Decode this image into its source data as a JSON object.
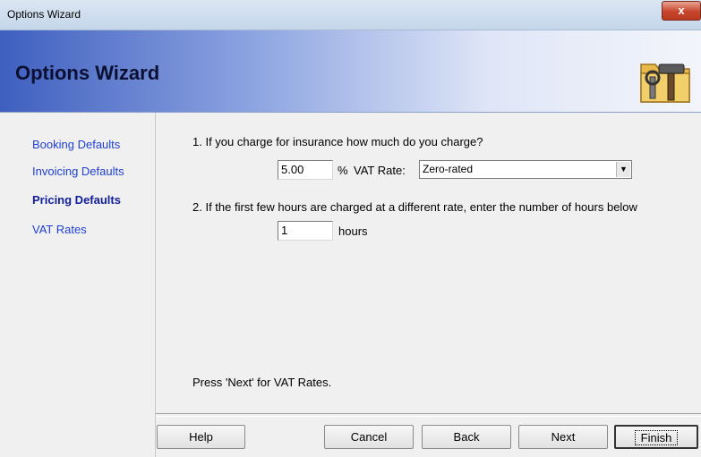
{
  "window": {
    "title": "Options Wizard",
    "close_label": "x"
  },
  "header": {
    "title": "Options Wizard",
    "icon": "folder-tools-icon"
  },
  "sidebar": {
    "items": [
      {
        "label": "Booking Defaults",
        "active": false
      },
      {
        "label": "Invoicing Defaults",
        "active": false
      },
      {
        "label": "Pricing Defaults",
        "active": true
      },
      {
        "label": "VAT Rates",
        "active": false
      }
    ]
  },
  "content": {
    "q1": {
      "text": "1. If you charge for insurance how much do you charge?",
      "value": "5.00",
      "suffix": "%",
      "vat_label": "VAT Rate:",
      "vat_selected": "Zero-rated"
    },
    "q2": {
      "text": "2. If the first few hours are charged at a different rate, enter the number of hours below",
      "value": "1",
      "unit": "hours"
    },
    "hint": "Press 'Next' for VAT Rates."
  },
  "buttons": {
    "help": "Help",
    "cancel": "Cancel",
    "back": "Back",
    "next": "Next",
    "finish": "Finish"
  }
}
